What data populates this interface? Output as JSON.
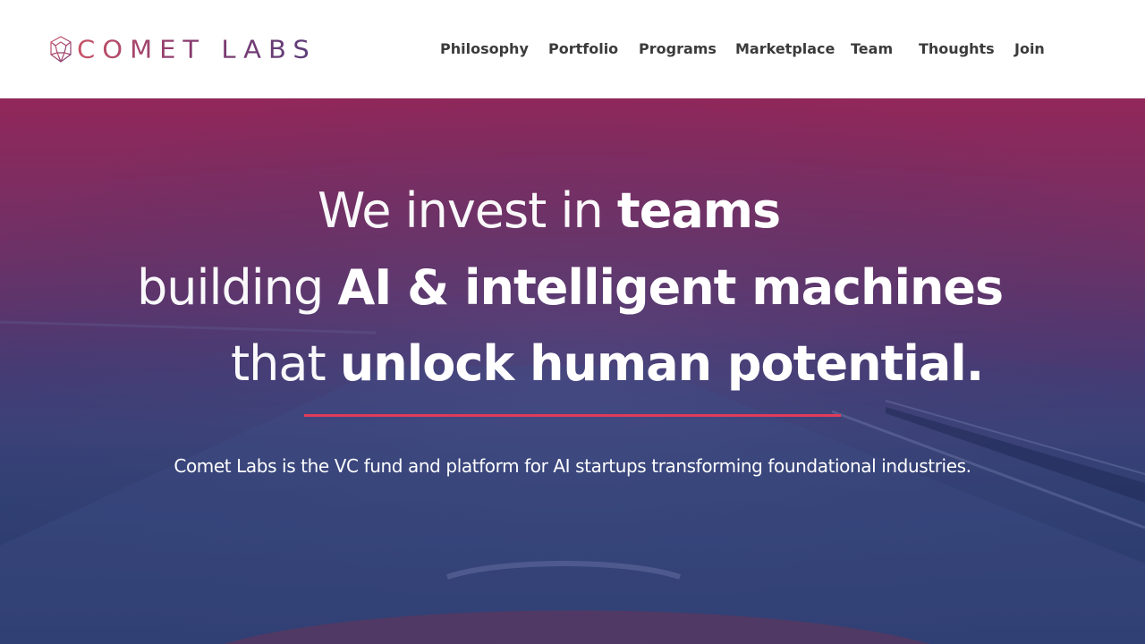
{
  "brand": {
    "name": "COMET LABS",
    "logo_icon": "geodesic-sphere-icon",
    "gradient_start": "#c85468",
    "gradient_end": "#5a3d7a"
  },
  "nav": {
    "items": [
      {
        "label": "Philosophy"
      },
      {
        "label": "Portfolio"
      },
      {
        "label": "Programs"
      },
      {
        "label": "Marketplace"
      },
      {
        "label": "Team"
      },
      {
        "label": "Thoughts"
      },
      {
        "label": "Join"
      }
    ]
  },
  "hero": {
    "line1": {
      "thin": "We invest in ",
      "bold": "teams"
    },
    "line2": {
      "thin": "building ",
      "bold": "AI & intelligent machines"
    },
    "line3": {
      "thin": "that ",
      "bold": "unlock human potential."
    },
    "subtitle": "Comet Labs is the VC fund and platform for AI startups transforming foundational industries.",
    "accent_color": "#e23a5a",
    "background_top": "#92275a",
    "background_bottom": "#273869"
  }
}
